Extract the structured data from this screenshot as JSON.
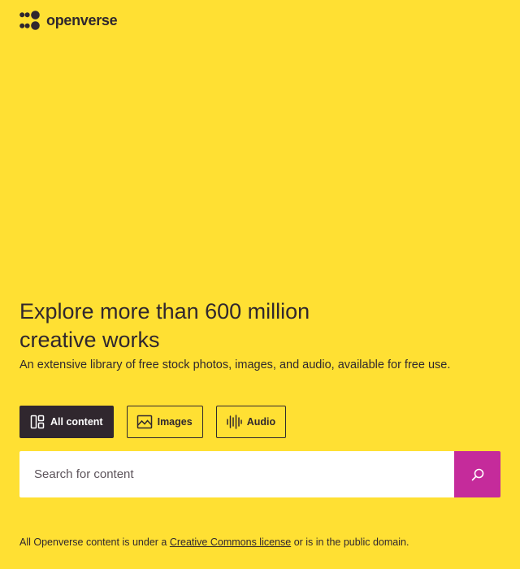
{
  "header": {
    "logo_text": "openverse"
  },
  "hero": {
    "headline": "Explore more than 600 million creative works",
    "subheadline": "An extensive library of free stock photos, images, and audio, available for free use."
  },
  "content_types": [
    {
      "label": "All content",
      "icon": "all-content-icon",
      "selected": true
    },
    {
      "label": "Images",
      "icon": "image-icon",
      "selected": false
    },
    {
      "label": "Audio",
      "icon": "audio-icon",
      "selected": false
    }
  ],
  "search": {
    "placeholder": "Search for content",
    "button_icon": "search-icon"
  },
  "footer": {
    "text_before": "All Openverse content is under a",
    "link_text": "Creative Commons license",
    "text_after": "or is in the public domain."
  },
  "colors": {
    "background": "#FFE033",
    "text": "#30272E",
    "search_button": "#C52B9B",
    "selected_button": "#30272E"
  }
}
